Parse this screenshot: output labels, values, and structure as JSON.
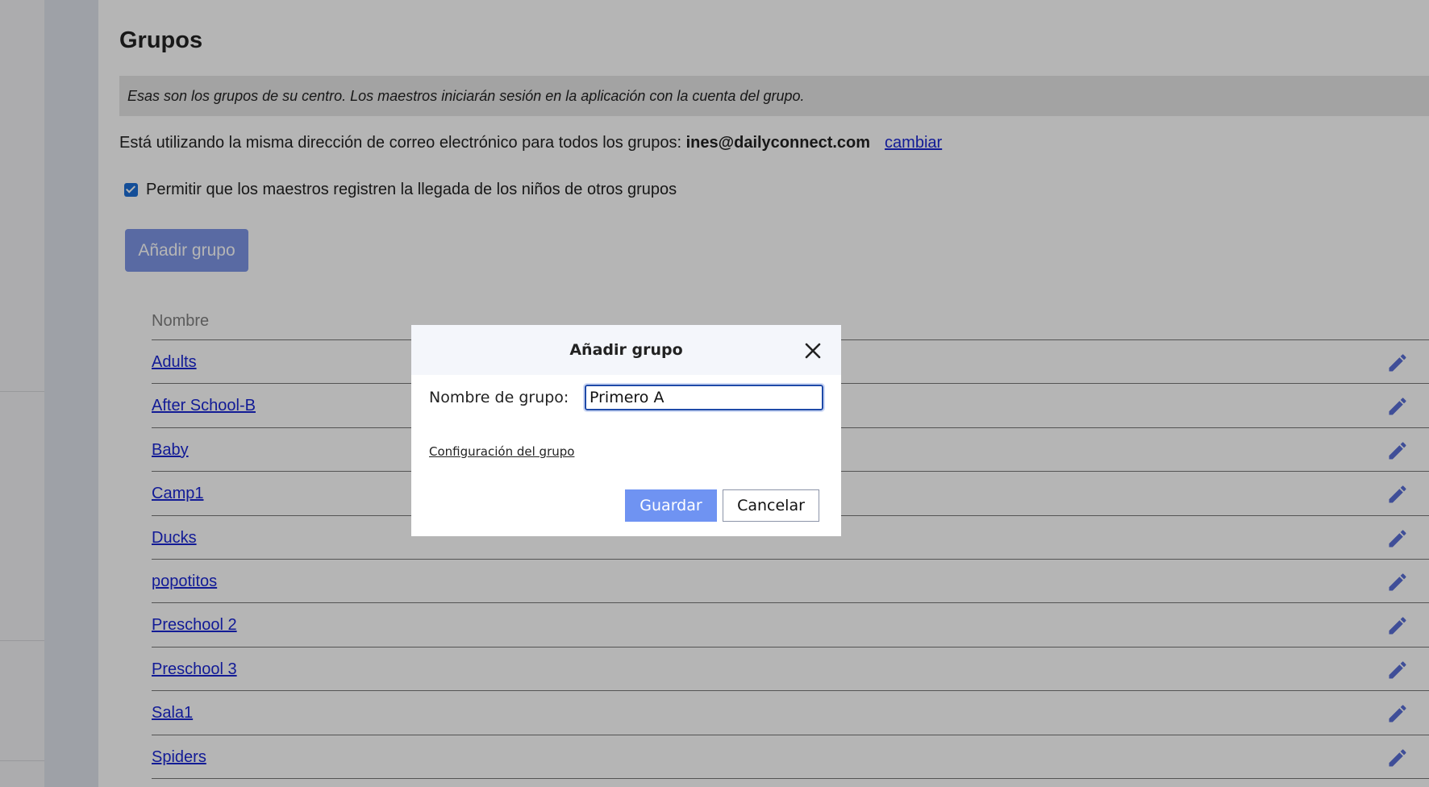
{
  "page": {
    "title": "Grupos",
    "info": "Esas son los grupos de su centro. Los maestros iniciarán sesión en la aplicación con la cuenta del grupo.",
    "email_prefix": "Está utilizando la misma dirección de correo electrónico para todos los grupos: ",
    "email": "ines@dailyconnect.com",
    "change_link": "cambiar",
    "checkbox_label": "Permitir que los maestros registren la llegada de los niños de otros grupos",
    "checkbox_checked": true,
    "add_group_button": "Añadir grupo"
  },
  "table": {
    "column_name": "Nombre",
    "rows": [
      {
        "name": "Adults"
      },
      {
        "name": "After School-B"
      },
      {
        "name": "Baby"
      },
      {
        "name": "Camp1"
      },
      {
        "name": "Ducks"
      },
      {
        "name": "popotitos"
      },
      {
        "name": "Preschool 2"
      },
      {
        "name": "Preschool 3"
      },
      {
        "name": "Sala1"
      },
      {
        "name": "Spiders"
      }
    ]
  },
  "modal": {
    "title": "Añadir grupo",
    "field_label": "Nombre de grupo:",
    "field_value": "Primero A",
    "config_link": "Configuración del grupo",
    "save_label": "Guardar",
    "cancel_label": "Cancelar"
  },
  "icons": {
    "edit": "pencil-icon",
    "close": "close-icon",
    "checkbox": "checkmark-icon"
  },
  "colors": {
    "link": "#1a26d4",
    "primary_button": "#6f93f2",
    "edit_icon": "#5a6fd6",
    "checkbox": "#1d6fd6"
  }
}
